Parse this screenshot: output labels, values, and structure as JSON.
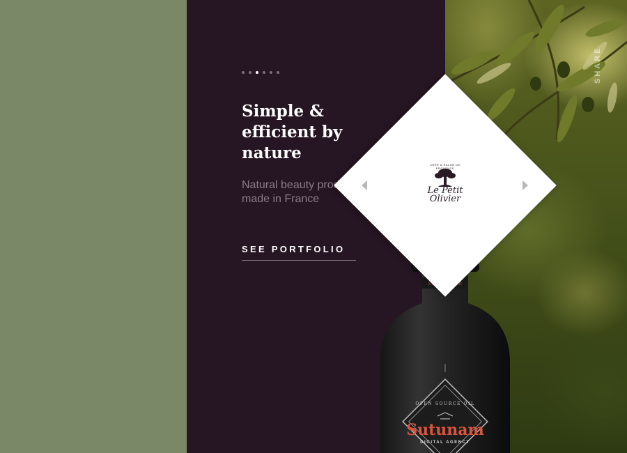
{
  "slider": {
    "dot_count": 6,
    "active_index": 2
  },
  "hero": {
    "headline": "Simple & efficient by nature",
    "subtext": "Natural beauty products made in France",
    "cta_label": "SEE PORTFOLIO"
  },
  "sidebar": {
    "share_label": "SHARE"
  },
  "showcase": {
    "logo_name": "Le Petit Olivier",
    "logo_tagline": "CRÉÉ À SALON DE PROVENCE",
    "prev_icon": "triangle-left-icon",
    "next_icon": "triangle-right-icon"
  },
  "bottle": {
    "neck_text": "SED BY OUR",
    "label_top": "OPEN SOURCE OIL",
    "brand": "Sutunam",
    "label_sub": "DIGITAL AGENCY"
  },
  "colors": {
    "green_panel": "#7a8868",
    "dark_panel": "#261522",
    "muted_text": "#8a7c88",
    "brand_red": "#d8553d"
  }
}
